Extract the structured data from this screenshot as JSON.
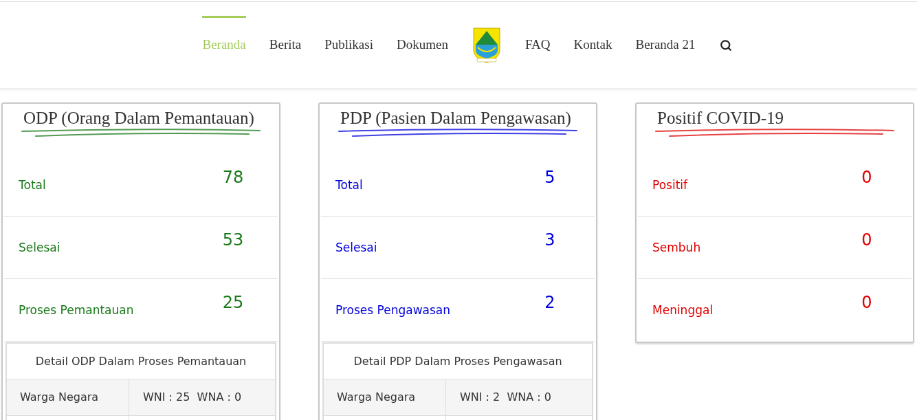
{
  "nav": [
    {
      "label": "Beranda",
      "selected": true
    },
    {
      "label": "Berita",
      "selected": false
    },
    {
      "label": "Publikasi",
      "selected": false
    },
    {
      "label": "Dokumen",
      "selected": false
    },
    {
      "kind": "logo"
    },
    {
      "label": "FAQ",
      "selected": false
    },
    {
      "label": "Kontak",
      "selected": false
    },
    {
      "label": "Beranda 21",
      "selected": false
    },
    {
      "kind": "search"
    }
  ],
  "cards": [
    {
      "title": "ODP (Orang Dalam Pemantauan)",
      "color": "#1a7a1a",
      "rows": [
        {
          "label": "Total",
          "value": "78"
        },
        {
          "label": "Selesai",
          "value": "53"
        },
        {
          "label": "Proses Pemantauan",
          "value": "25"
        }
      ],
      "detail": {
        "title": "Detail ODP Dalam Proses Pemantauan",
        "rows": [
          {
            "label": "Warga Negara",
            "value": "WNI : 25  WNA : 0"
          }
        ]
      }
    },
    {
      "title": "PDP (Pasien Dalam Pengawasan)",
      "color": "#0000dd",
      "rows": [
        {
          "label": "Total",
          "value": "5"
        },
        {
          "label": "Selesai",
          "value": "3"
        },
        {
          "label": "Proses Pengawasan",
          "value": "2"
        }
      ],
      "detail": {
        "title": "Detail PDP Dalam Proses Pengawasan",
        "rows": [
          {
            "label": "Warga Negara",
            "value": "WNI : 2  WNA : 0"
          }
        ]
      }
    },
    {
      "title": "Positif COVID-19",
      "color": "#e00000",
      "rows": [
        {
          "label": "Positif",
          "value": "0"
        },
        {
          "label": "Sembuh",
          "value": "0"
        },
        {
          "label": "Meninggal",
          "value": "0"
        }
      ]
    }
  ]
}
